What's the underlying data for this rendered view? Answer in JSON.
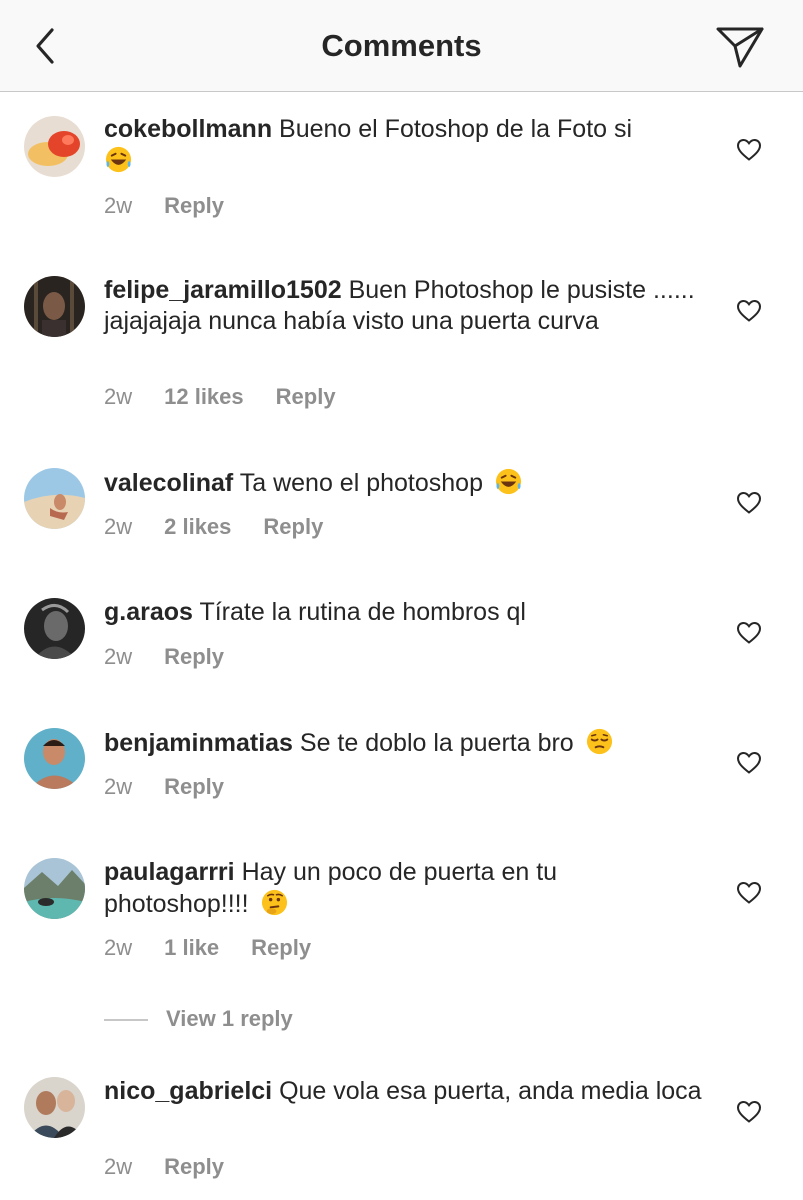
{
  "header": {
    "title": "Comments"
  },
  "comments": [
    {
      "username": "cokebollmann",
      "text": "Bueno el Fotoshop de la Foto si",
      "emoji": "laughing-tears",
      "time": "2w",
      "likes": "",
      "reply": "Reply"
    },
    {
      "username": "felipe_jaramillo1502",
      "text": "Buen Photoshop le pusiste ...... jajajajaja nunca había visto una puerta curva",
      "emoji": "",
      "time": "2w",
      "likes": "12 likes",
      "reply": "Reply"
    },
    {
      "username": "valecolinaf",
      "text": "Ta weno el photoshop",
      "emoji": "laughing-tears",
      "time": "2w",
      "likes": "2 likes",
      "reply": "Reply"
    },
    {
      "username": "g.araos",
      "text": "Tírate la rutina de hombros ql",
      "emoji": "",
      "time": "2w",
      "likes": "",
      "reply": "Reply"
    },
    {
      "username": "benjaminmatias",
      "text": "Se te doblo la puerta bro",
      "emoji": "pensive",
      "time": "2w",
      "likes": "",
      "reply": "Reply"
    },
    {
      "username": "paulagarrri",
      "text": "Hay un poco de puerta en tu photoshop!!!!",
      "emoji": "thinking",
      "time": "2w",
      "likes": "1 like",
      "reply": "Reply"
    },
    {
      "username": "nico_gabrielci",
      "text": "Que vola esa puerta, anda media loca",
      "emoji": "",
      "time": "2w",
      "likes": "",
      "reply": "Reply"
    }
  ],
  "view_replies": {
    "label": "View 1 reply"
  },
  "icons": {
    "back": "chevron-left-icon",
    "share": "send-icon",
    "like": "heart-outline-icon"
  },
  "colors": {
    "text": "#262626",
    "muted": "#8e8e8e",
    "header_bg": "#f9f9f9"
  }
}
